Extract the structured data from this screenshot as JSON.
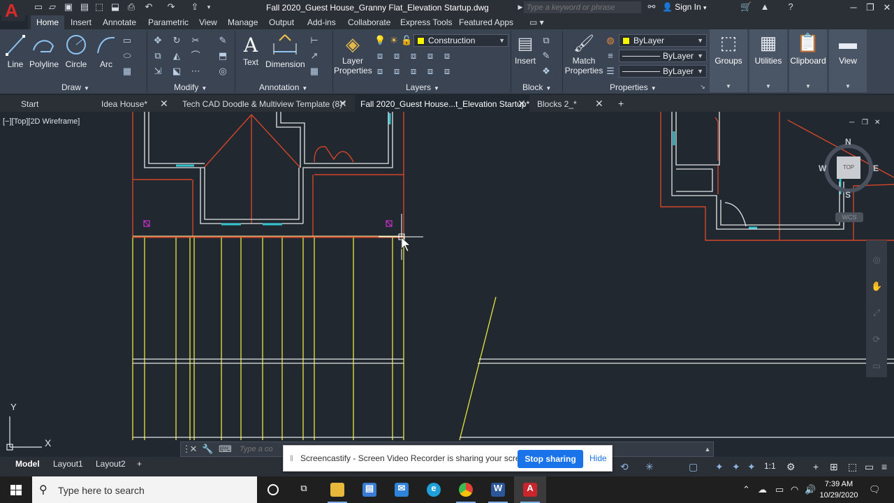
{
  "app": {
    "logo_letter": "A",
    "document_title": "Fall 2020_Guest House_Granny Flat_Elevation Startup.dwg",
    "search_placeholder": "Type a keyword or phrase",
    "sign_in": "Sign In"
  },
  "ribbon_tabs": [
    "Home",
    "Insert",
    "Annotate",
    "Parametric",
    "View",
    "Manage",
    "Output",
    "Add-ins",
    "Collaborate",
    "Express Tools",
    "Featured Apps"
  ],
  "ribbon": {
    "draw": {
      "title": "Draw",
      "tools": [
        "Line",
        "Polyline",
        "Circle",
        "Arc"
      ]
    },
    "modify": {
      "title": "Modify"
    },
    "annotation": {
      "title": "Annotation",
      "tools": [
        "Text",
        "Dimension"
      ]
    },
    "layers": {
      "title": "Layers",
      "layer_properties": "Layer\nProperties",
      "current_layer": "Construction"
    },
    "block": {
      "title": "Block",
      "insert": "Insert"
    },
    "properties": {
      "title": "Properties",
      "match": "Match\nProperties",
      "color": "ByLayer",
      "linetype": "ByLayer",
      "lineweight": "ByLayer"
    },
    "groups": "Groups",
    "utilities": "Utilities",
    "clipboard": "Clipboard",
    "view": "View"
  },
  "doc_tabs": [
    {
      "label": "Start",
      "closable": false
    },
    {
      "label": "Idea House*",
      "closable": true
    },
    {
      "label": "Tech CAD Doodle & Multiview Template (8)*",
      "closable": true
    },
    {
      "label": "Fall 2020_Guest House...t_Elevation Startup*",
      "closable": true,
      "active": true
    },
    {
      "label": "Blocks 2_*",
      "closable": true
    }
  ],
  "viewport": {
    "label": "[−][Top][2D Wireframe]",
    "viewcube": {
      "north": "N",
      "south": "S",
      "east": "E",
      "west": "W",
      "face": "TOP",
      "wcs": "WCS"
    },
    "ucs_x": "X",
    "ucs_y": "Y"
  },
  "command_line": {
    "placeholder": "Type a co"
  },
  "layout_tabs": [
    "Model",
    "Layout1",
    "Layout2"
  ],
  "status": {
    "scale": "1:1"
  },
  "banner": {
    "message": "Screencastify - Screen Video Recorder is sharing your screen.",
    "stop_button": "Stop sharing",
    "hide_link": "Hide"
  },
  "taskbar": {
    "search_placeholder": "Type here to search",
    "time": "7:39 AM",
    "date": "10/29/2020",
    "apps": [
      "task-view",
      "file-explorer",
      "store",
      "mail",
      "edge",
      "chrome",
      "word",
      "autocad"
    ]
  },
  "colors": {
    "accent": "#1a73e8",
    "autocad_red": "#d62b2b",
    "layer_yellow": "#f5f500",
    "construction_orange": "#d2452a",
    "cyan": "#33c2cc"
  }
}
